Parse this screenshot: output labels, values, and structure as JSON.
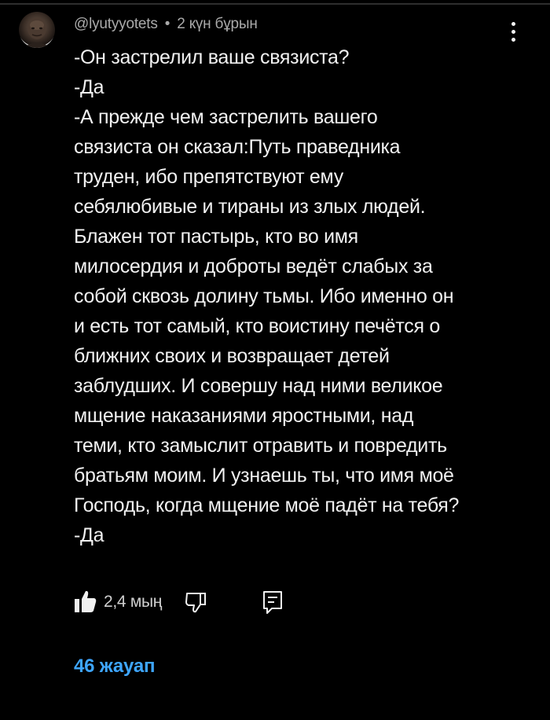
{
  "comment": {
    "avatar_icon": "user-avatar",
    "author": "@lyutyyotets",
    "separator": "•",
    "time_ago": "2 күн бұрын",
    "text_lines": [
      "-Он застрелил ваше связиста?",
      "-Да",
      "-А прежде чем застрелить вашего",
      "связиста он сказал:Путь праведника",
      "труден, ибо препятствуют ему",
      "себялюбивые и тираны из злых людей.",
      "Блажен тот пастырь, кто во имя",
      "милосердия и доброты ведёт слабых за",
      "собой сквозь долину тьмы. Ибо именно он",
      "и есть тот самый, кто воистину печётся о",
      "ближних своих и возвращает детей",
      "заблудших. И совершу над ними великое",
      "мщение наказаниями яростными, над",
      "теми, кто замыслит отравить и повредить",
      "братьям моим. И узнаешь ты, что имя моё",
      "Господь, когда мщение моё падёт на тебя?",
      "-Да"
    ],
    "menu_icon": "more-vertical-icon"
  },
  "actions": {
    "like_icon": "thumbs-up-filled-icon",
    "like_count": "2,4 мың",
    "dislike_icon": "thumbs-down-outline-icon",
    "reply_icon": "reply-comment-icon"
  },
  "replies": {
    "label": "46 жауап"
  },
  "colors": {
    "background": "#000000",
    "text": "#f1f1f1",
    "meta": "#aaaaaa",
    "link": "#3ea6ff"
  }
}
